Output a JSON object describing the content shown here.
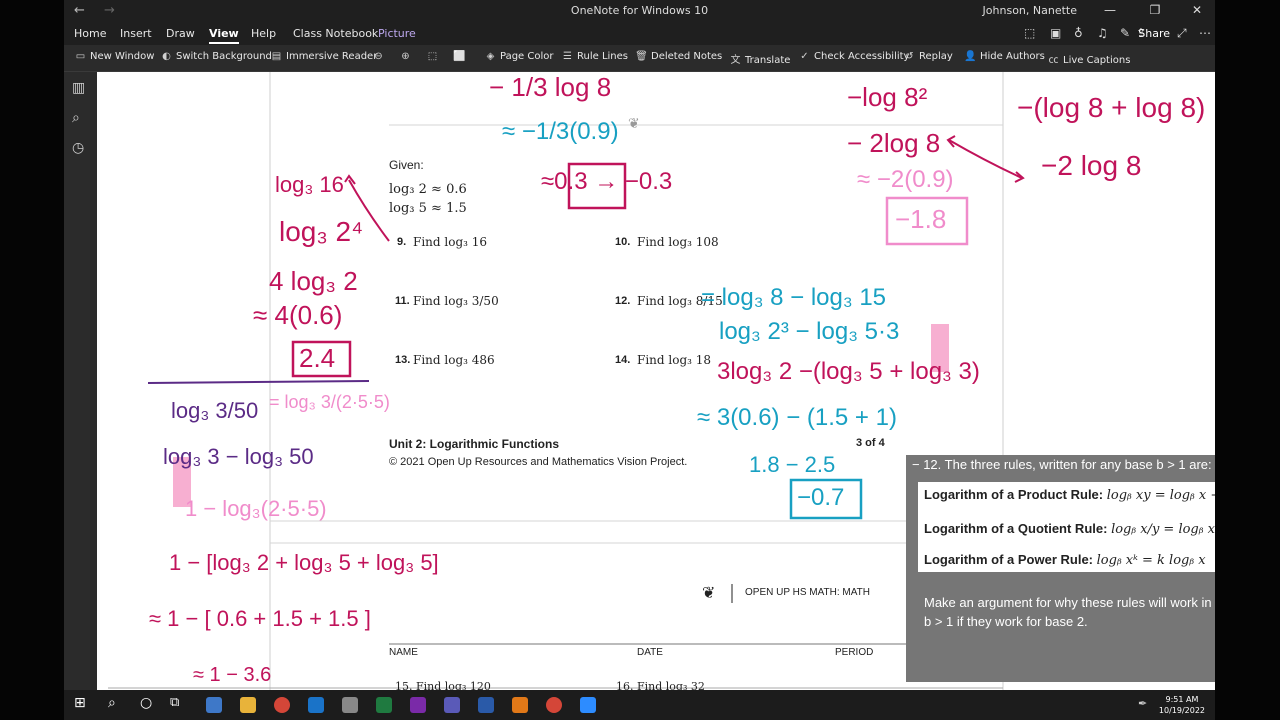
{
  "window": {
    "title": "OneNote for Windows 10",
    "user": "Johnson, Nanette"
  },
  "tabs": [
    "Home",
    "Insert",
    "Draw",
    "View",
    "Help",
    "Class Notebook",
    "Picture"
  ],
  "share_label": "Share",
  "ribbon": [
    "New Window",
    "Switch Background",
    "Immersive Reader",
    "Page Color",
    "Rule Lines",
    "Deleted Notes",
    "Translate",
    "Check Accessibility",
    "Replay",
    "Hide Authors",
    "Live Captions"
  ],
  "doc": {
    "given_label": "Given:",
    "given1": "log₃ 2 ≈ 0.6",
    "given2": "log₃ 5 ≈ 1.5",
    "problems": [
      {
        "num": "9.",
        "text": "Find log₃ 16"
      },
      {
        "num": "10.",
        "text": "Find log₃ 108"
      },
      {
        "num": "11.",
        "text": "Find log₃ 3/50"
      },
      {
        "num": "12.",
        "text": "Find log₃ 8/15"
      },
      {
        "num": "13.",
        "text": "Find log₃ 486"
      },
      {
        "num": "14.",
        "text": "Find log₃ 18"
      }
    ],
    "footer_unit": "Unit 2: Logarithmic Functions",
    "footer_page": "3 of 4",
    "footer_copy": "© 2021 Open Up Resources and Mathematics Vision Project.",
    "next_header": "OPEN UP HS MATH: MATH",
    "name_label": "NAME",
    "date_label": "DATE",
    "period_label": "PERIOD",
    "cut_15": "15. Find log₃ 120",
    "cut_16": "16. Find log₃ 32"
  },
  "popup": {
    "heading": "− 12.  The three rules, written for any base b > 1 are:",
    "rule1_label": "Logarithm of a Product Rule:",
    "rule1_formula": "logᵦ xy = logᵦ x + lo",
    "rule2_label": "Logarithm of a Quotient Rule:",
    "rule2_formula": "logᵦ x/y = logᵦ x − lo",
    "rule3_label": "Logarithm of a Power Rule:",
    "rule3_formula": "logᵦ xᵏ = k logᵦ x",
    "argument_line1": "Make an argument for why these rules will work in a",
    "argument_line2": "b > 1 if they work for base 2."
  },
  "ink": {
    "top_left_1": "− 1/3 log 8",
    "top_left_2": "≈ −1/3(0.9)",
    "top_left_3": "≈0.3 → −0.3",
    "top_right_1": "−log 8²",
    "top_right_2": "− 2log 8",
    "top_right_3": "≈ −2(0.9)",
    "top_right_4": "−1.8",
    "far_right_1": "−(log 8 + log 8)",
    "far_right_2": "−2 log 8",
    "p9_1": "log₃ 16",
    "p9_2": "log₃ 2⁴",
    "p9_3": "4 log₃ 2",
    "p9_4": "≈ 4(0.6)",
    "p9_5": "2.4",
    "p12_1": "= log₃ 8 − log₃ 15",
    "p12_2": "log₃ 2³ − log₃ 5·3",
    "p12_3": "3log₃ 2 −(log₃ 5 + log₃ 3)",
    "p12_4": "≈ 3(0.6) − (1.5 + 1)",
    "p12_5": "1.8  − 2.5",
    "p12_6": "−0.7",
    "p11_1": "log₃ 3/50",
    "p11_2": "= log₃ 3/(2·5·5)",
    "p11_3": "log₃ 3 − log₃ 50",
    "p11_4": "1 − log₃(2·5·5)",
    "p11_5": "1 − [log₃ 2 + log₃ 5 + log₃ 5]",
    "p11_6": "≈ 1 − [ 0.6 + 1.5 + 1.5 ]",
    "p11_7": "≈ 1 − 3.6"
  },
  "taskbar": {
    "time": "9:51 AM",
    "date": "10/19/2022"
  },
  "colors": {
    "magenta": "#c0135a",
    "teal": "#18a0c2",
    "pink": "#f08ccb",
    "purple": "#5b2b86",
    "highlight": "#f6a6cc",
    "yellow": "#f7e64a"
  }
}
